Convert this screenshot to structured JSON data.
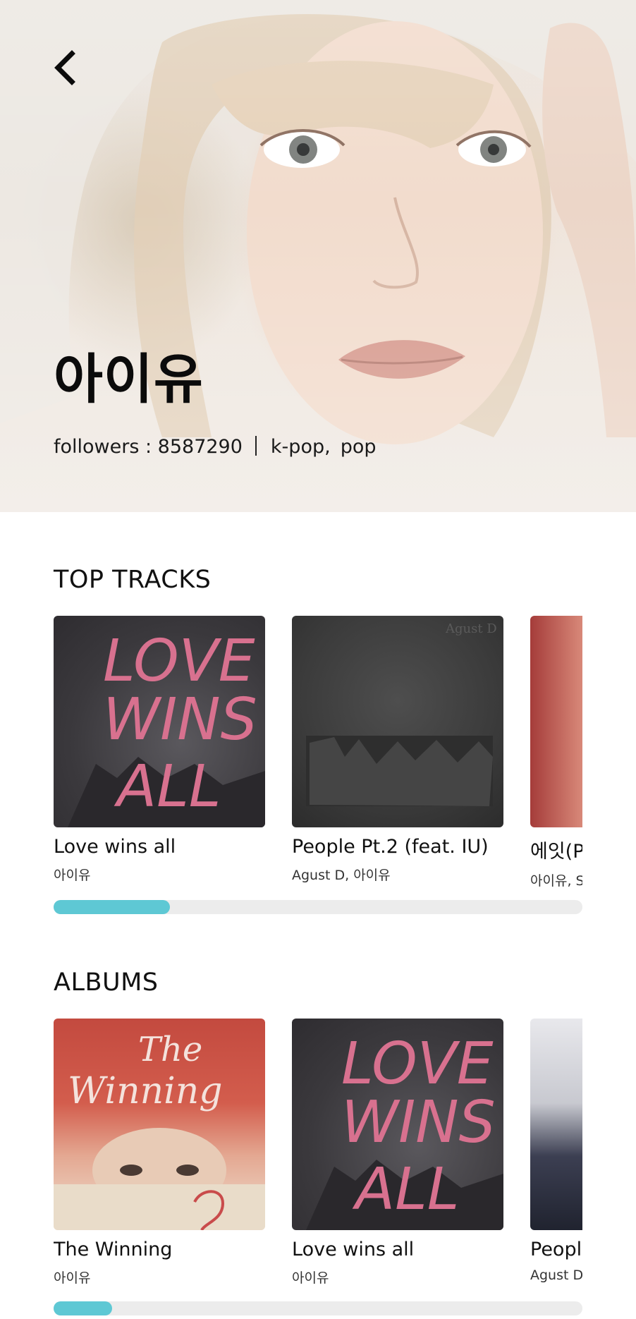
{
  "artist": {
    "name": "아이유",
    "followers_text": "followers : 8587290",
    "genres": [
      "k-pop,",
      "pop"
    ]
  },
  "top_tracks": {
    "title": "TOP TRACKS",
    "items": [
      {
        "title": "Love wins all",
        "artists": "아이유"
      },
      {
        "title": "People Pt.2 (feat. IU)",
        "artists": "Agust D, 아이유"
      },
      {
        "title": "에잇(P",
        "artists": "아이유, S"
      }
    ],
    "scroll_position": 0.22
  },
  "albums": {
    "title": "ALBUMS",
    "items": [
      {
        "title": "The Winning",
        "artists": "아이유"
      },
      {
        "title": "Love wins all",
        "artists": "아이유"
      },
      {
        "title": "Peopl",
        "artists": "Agust D"
      }
    ],
    "scroll_position": 0.11
  },
  "cover_art": {
    "love_wins_all": [
      "LOVE",
      "WINS",
      "ALL"
    ],
    "people_pt2_text": "Agust D",
    "winning": [
      "The",
      "Winning"
    ]
  },
  "colors": {
    "accent": "#5ec8d4",
    "scroll_track": "#ececec",
    "cover_pink": "#d8718f"
  },
  "icons": {
    "back": "chevron-left-icon"
  }
}
